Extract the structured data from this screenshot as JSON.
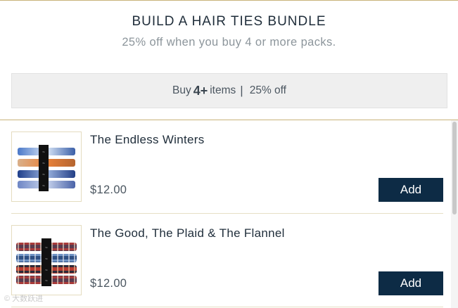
{
  "header": {
    "title": "BUILD A HAIR TIES BUNDLE",
    "subtitle": "25% off when you buy 4 or more packs."
  },
  "deal": {
    "prefix": "Buy",
    "quantity": "4+",
    "suffix": "items",
    "separator": "|",
    "discount": "25% off"
  },
  "products": [
    {
      "name": "The Endless Winters",
      "price": "$12.00",
      "add_label": "Add",
      "image_icon": "hair-ties-winter-pattern"
    },
    {
      "name": "The Good, The Plaid & The Flannel",
      "price": "$12.00",
      "add_label": "Add",
      "image_icon": "hair-ties-plaid-pattern"
    }
  ],
  "colors": {
    "accent_rule": "#c9b37a",
    "button_bg": "#0d2b45",
    "deal_bar_bg": "#efefef"
  },
  "watermark": "© 大数跃进"
}
